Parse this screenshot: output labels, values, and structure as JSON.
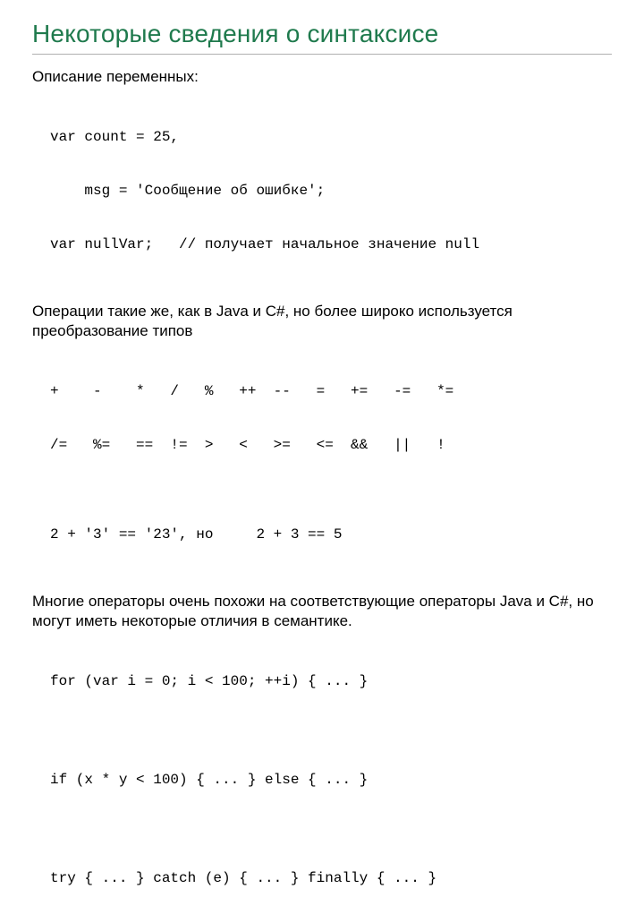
{
  "title": "Некоторые сведения о синтаксисе",
  "p1": "Описание переменных:",
  "code1": {
    "l1": "var count = 25,",
    "l2": "    msg = 'Сообщение об ошибке';",
    "l3": "var nullVar;   // получает начальное значение null"
  },
  "p2": "Операции такие же, как в Java и C#, но более широко используется преобразование типов",
  "code2": {
    "l1": "+    -    *   /   %   ++  --   =   +=   -=   *=",
    "l2": "/=   %=   ==  !=  >   <   >=   <=  &&   ||   !",
    "l3": "",
    "l4": "2 + '3' == '23', но     2 + 3 == 5"
  },
  "p3": "Многие операторы очень похожи на соответствующие операторы Java и C#, но могут иметь некоторые отличия в семантике.",
  "code3": {
    "l1": "for (var i = 0; i < 100; ++i) { ... }",
    "l2": "if (x * y < 100) { ... } else { ... }",
    "l3": "try { ... } catch (e) { ... } finally { ... }"
  }
}
